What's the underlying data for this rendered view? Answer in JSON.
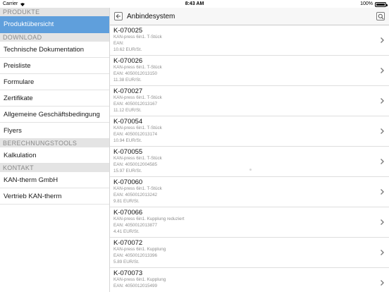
{
  "status_bar": {
    "carrier": "Carrier",
    "time": "8:43 AM",
    "battery": "100%",
    "battery_level": 1.0
  },
  "sidebar": {
    "sections": [
      {
        "header": "PRODUKTE",
        "items": [
          {
            "label": "Produktübersicht",
            "selected": true
          }
        ]
      },
      {
        "header": "DOWNLOAD",
        "items": [
          {
            "label": "Technische Dokumentation"
          },
          {
            "label": "Preisliste"
          },
          {
            "label": "Formulare"
          },
          {
            "label": "Zertifikate"
          },
          {
            "label": "Allgemeine Geschäftsbedingung"
          },
          {
            "label": "Flyers"
          }
        ]
      },
      {
        "header": "BERECHNUNGSTOOLS",
        "items": [
          {
            "label": "Kalkulation"
          }
        ]
      },
      {
        "header": "KONTAKT",
        "items": [
          {
            "label": "KAN-therm GmbH"
          },
          {
            "label": "Vertrieb KAN-therm"
          }
        ]
      }
    ]
  },
  "main": {
    "title": "Anbindesystem",
    "back_icon": "back-arrow-icon",
    "search_icon": "search-icon",
    "products": [
      {
        "code": "K-070025",
        "name": "KAN-press 6in1. T-Stück",
        "ean": "EAN:",
        "price": "10.62 EUR/St."
      },
      {
        "code": "K-070026",
        "name": "KAN-press 6in1. T-Stück",
        "ean": "EAN: 4050012013150",
        "price": "11.38 EUR/St."
      },
      {
        "code": "K-070027",
        "name": "KAN-press 6in1. T-Stück",
        "ean": "EAN: 4050012013167",
        "price": "11.12 EUR/St."
      },
      {
        "code": "K-070054",
        "name": "KAN-press 6in1. T-Stück",
        "ean": "EAN: 4050012013174",
        "price": "10.94 EUR/St."
      },
      {
        "code": "K-070055",
        "name": "KAN-press 6in1. T-Stück",
        "ean": "EAN: 4050012004585",
        "price": "15.97 EUR/St."
      },
      {
        "code": "K-070060",
        "name": "KAN-press 6in1. T-Stück",
        "ean": "EAN: 4050012013242",
        "price": "9.81 EUR/St."
      },
      {
        "code": "K-070066",
        "name": "KAN-press 6in1. Kupplung reduziert",
        "ean": "EAN: 4050012013877",
        "price": "4.41 EUR/St."
      },
      {
        "code": "K-070072",
        "name": "KAN-press 6in1. Kupplung",
        "ean": "EAN: 4050012013396",
        "price": "5.89 EUR/St."
      },
      {
        "code": "K-070073",
        "name": "KAN-press 6in1. Kupplung",
        "ean": "EAN: 4050012015499",
        "price": ""
      }
    ]
  },
  "colors": {
    "selected": "#5f9fdc",
    "section_header_bg": "#e4e4e4",
    "section_header_text": "#8a8a8a"
  }
}
